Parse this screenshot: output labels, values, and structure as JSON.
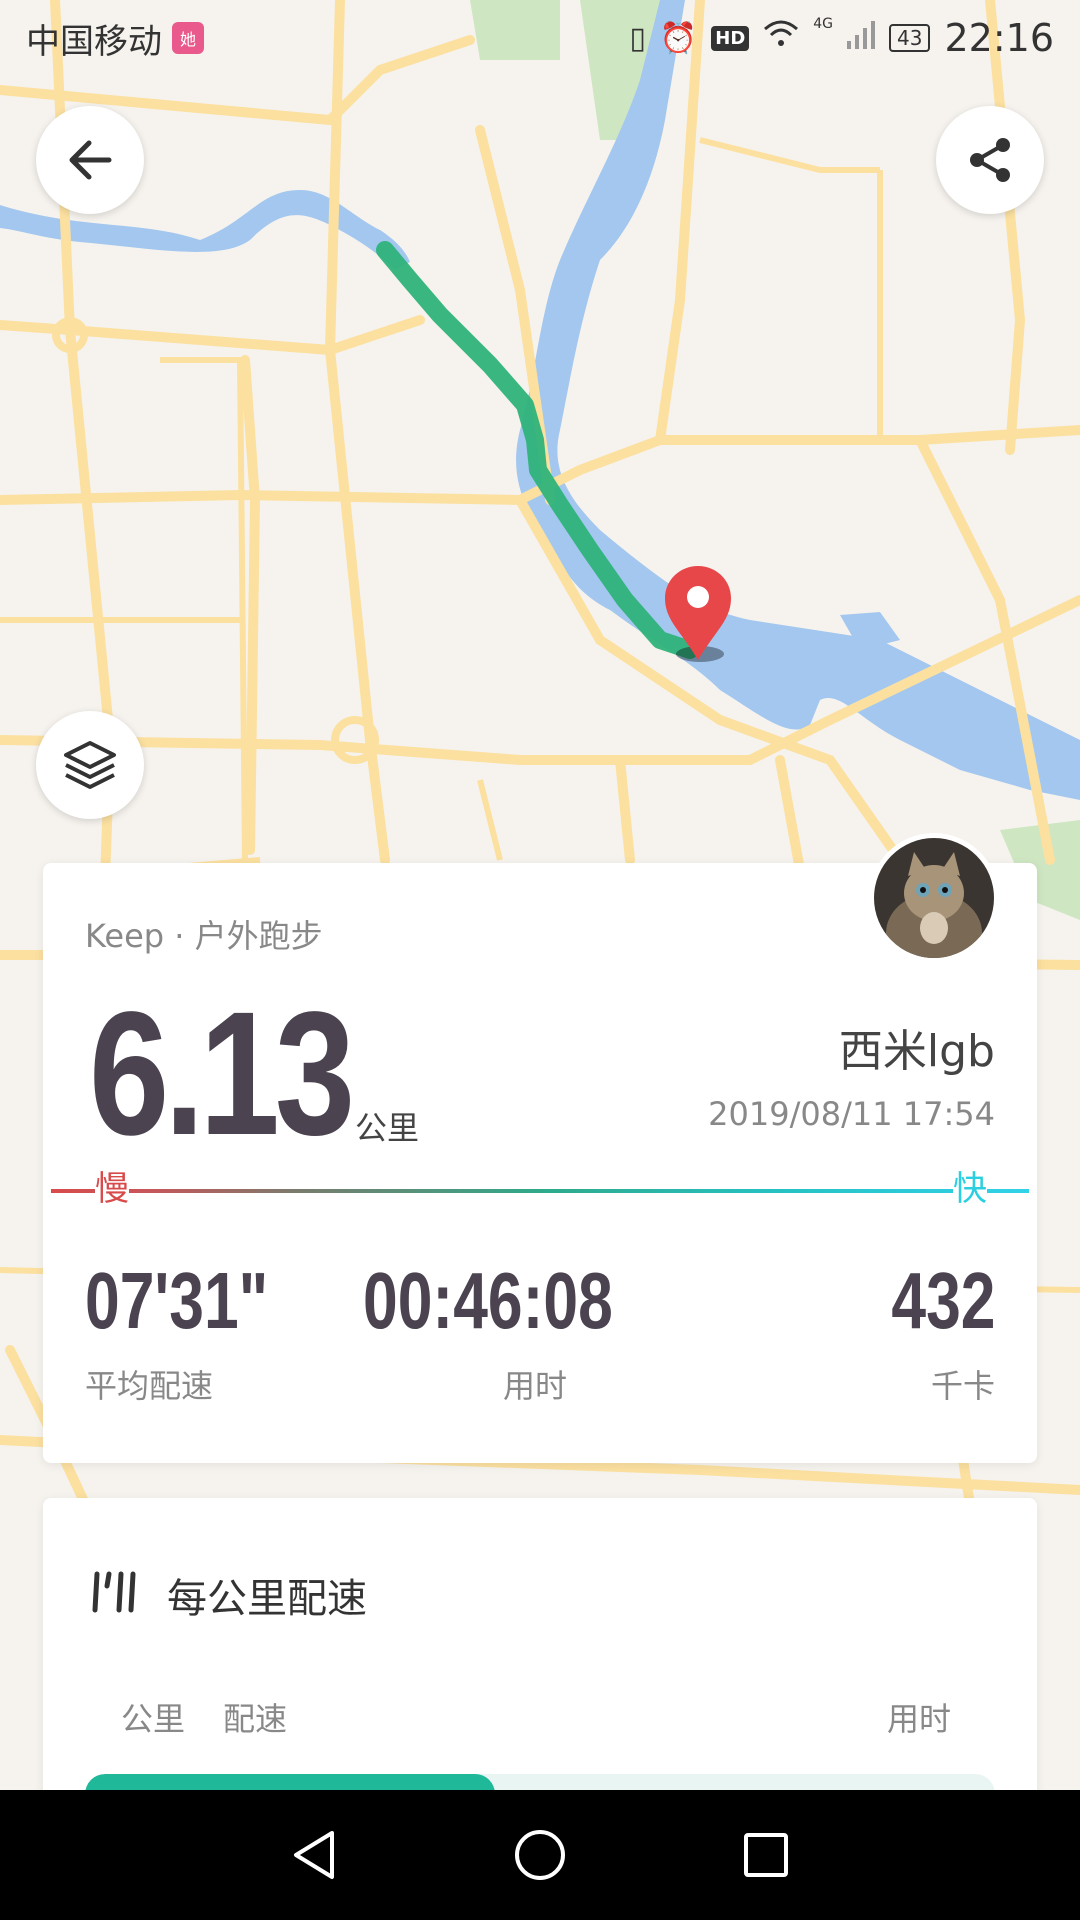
{
  "status_bar": {
    "carrier": "中国移动",
    "app_badge": "她",
    "hd": "HD",
    "network": "4G",
    "battery": "43",
    "time": "22:16"
  },
  "activity": {
    "source": "Keep · 户外跑步",
    "distance": "6.13",
    "distance_unit": "公里",
    "username": "西米lgb",
    "datetime": "2019/08/11 17:54",
    "slow_label": "慢",
    "fast_label": "快",
    "stats": [
      {
        "value": "07'31\"",
        "label": "平均配速"
      },
      {
        "value": "00:46:08",
        "label": "用时"
      },
      {
        "value": "432",
        "label": "千卡"
      }
    ]
  },
  "pace_section": {
    "title": "每公里配速",
    "columns": {
      "km": "公里",
      "pace": "配速",
      "time": "用时"
    },
    "first_bar_fraction": 0.45
  },
  "colors": {
    "route": "#2fb37a",
    "water": "#a3c7ef",
    "road": "#fbe0a0",
    "pin": "#e8474a",
    "accent": "#1fb99a"
  },
  "icons": {
    "back": "arrow-left-icon",
    "share": "share-icon",
    "layers": "layers-icon",
    "pin": "map-pin-icon",
    "pace": "pace-chart-icon"
  }
}
